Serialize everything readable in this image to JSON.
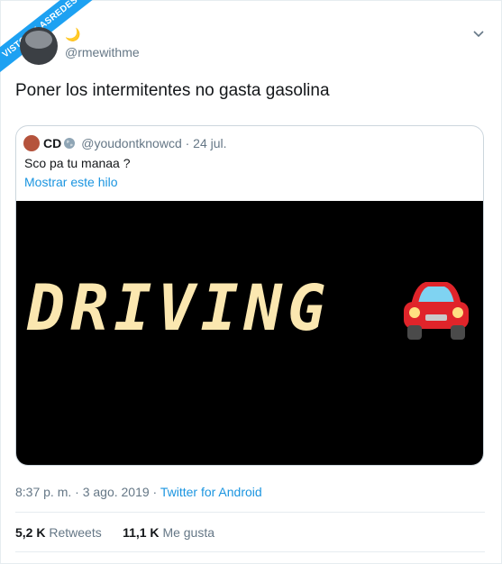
{
  "watermark": "VISTOENLASREDES",
  "tweet": {
    "moon": "🌙",
    "handle": "@rmewithme",
    "text": "Poner los intermitentes no gasta gasolina",
    "timestamp": "8:37 p. m. · 3 ago. 2019 · ",
    "source": "Twitter for Android",
    "retweets_count": "5,2 K",
    "retweets_label": "Retweets",
    "likes_count": "11,1 K",
    "likes_label": "Me gusta"
  },
  "quoted": {
    "name": "CD",
    "handle_date": "@youdontknowcd · 24 jul.",
    "text": "Sco pa tu manaa ?",
    "thread_link": "Mostrar este hilo",
    "media_text": "DRIVING",
    "media_emoji": "car-emoji"
  },
  "colors": {
    "link": "#1b95e0",
    "banner": "#1da1f2",
    "muted": "#657786",
    "driving_text": "#fbe7b0"
  }
}
